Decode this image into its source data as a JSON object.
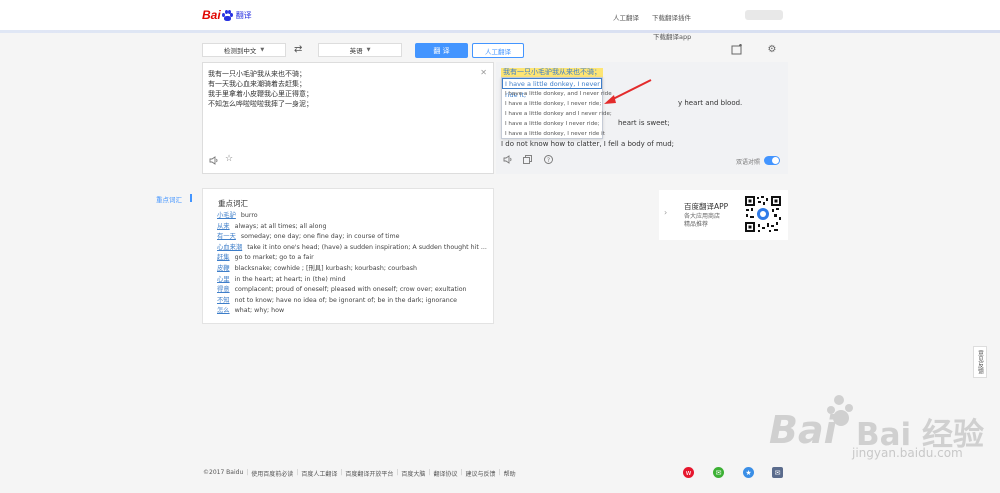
{
  "header": {
    "logo_text": "Bai",
    "logo_suffix": "翻译",
    "links": [
      "人工翻译",
      "下载翻译插件",
      "下载翻译app"
    ]
  },
  "lang_bar": {
    "source_lang": "检测到中文",
    "target_lang": "英语",
    "translate_button": "翻 译",
    "human_button": "人工翻译"
  },
  "input": {
    "text": "我有一只小毛驴我从来也不骑；\n有一天我心血来潮骑着去赶集；\n我手里拿着小皮鞭我心里正得意；\n不知怎么哗啦啦啦我摔了一身泥；"
  },
  "output": {
    "highlighted_source": "我有一只小毛驴我从来也不骑；",
    "suggestion_selected": "I have a little donkey, I never ride it;",
    "suggestions": [
      "I have a little donkey, and I never ride",
      "I have a little donkey, I never ride;",
      "I have a little donkey and I never ride;",
      "I have a little donkey I never ride;",
      "I have a little donkey, I never ride it"
    ],
    "line2_tail": "y heart and blood.",
    "line3_tail": "heart is sweet;",
    "line4": "I do not know how to clatter, I fell a body of mud;",
    "bilingual_label": "双语对照"
  },
  "keywords": {
    "tab_label": "重点词汇",
    "title": "重点词汇",
    "items": [
      {
        "word": "小毛驴",
        "def": "burro"
      },
      {
        "word": "从来",
        "def": "always; at all times; all along"
      },
      {
        "word": "有一天",
        "def": "someday; one day; one fine day; in course of time"
      },
      {
        "word": "心血来潮",
        "def": "take it into one's head; (have) a sudden inspiration; A sudden thought hit ..."
      },
      {
        "word": "赶集",
        "def": "go to market; go to a fair"
      },
      {
        "word": "皮鞭",
        "def": "blacksnake; cowhide ; [刑具] kurbash; kourbash; courbash"
      },
      {
        "word": "心里",
        "def": "in the heart; at heart; in (the) mind"
      },
      {
        "word": "得意",
        "def": "complacent; proud of oneself; pleased with oneself; crow over; exultation"
      },
      {
        "word": "不知",
        "def": "not to know; have no idea of; be ignorant of; be in the dark; ignorance"
      },
      {
        "word": "怎么",
        "def": "what; why; how"
      }
    ]
  },
  "app_card": {
    "name": "百度翻译APP",
    "line1": "各大应用商店",
    "line2": "精品推荐"
  },
  "feedback_label": "意见反馈",
  "watermark": {
    "text": "Bai 经验",
    "url": "jingyan.baidu.com"
  },
  "footer": {
    "items": [
      "©2017 Baidu",
      "使用百度前必读",
      "百度人工翻译",
      "百度翻译开放平台",
      "百度大脑",
      "翻译协议",
      "建议与反馈",
      "帮助"
    ]
  }
}
